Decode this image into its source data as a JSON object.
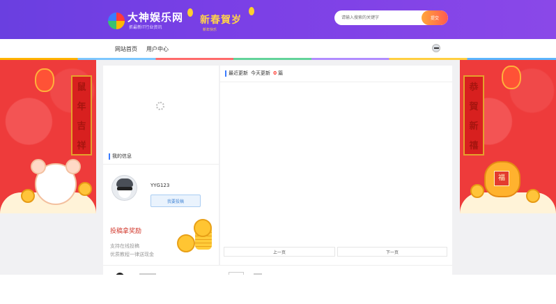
{
  "header": {
    "logo_title": "大神娱乐网",
    "logo_subtitle": "抓最新IT行业资讯",
    "banner_title": "新春賀岁",
    "banner_subtitle": "新年快乐",
    "search_placeholder": "请输入搜索的关键字",
    "search_button": "提交"
  },
  "nav": {
    "items": [
      {
        "label": "网站首页"
      },
      {
        "label": "用户中心"
      }
    ]
  },
  "decor": {
    "left_couplet": [
      "鼠",
      "年",
      "吉",
      "祥"
    ],
    "right_couplet": [
      "恭",
      "賀",
      "新",
      "禧"
    ],
    "bag_char": "福"
  },
  "profile": {
    "section_title": "我的信息",
    "username": "YYG123",
    "submit_button": "我要投稿",
    "reward_title": "投稿拿奖励",
    "reward_line1": "支持在线投稿",
    "reward_line2": "优质教程一律送现金"
  },
  "main": {
    "title": "最近更新",
    "today_label": "今天更新",
    "today_count": "0",
    "today_unit": "篇",
    "prev_button": "上一页",
    "next_button": "下一页"
  },
  "colors": {
    "header_gradient_start": "#6a3fe0",
    "header_gradient_end": "#8a48e8",
    "accent_blue": "#3a7bff",
    "accent_red": "#ff3b30",
    "festive_red": "#ee3b3b",
    "gold": "#ffc532"
  }
}
